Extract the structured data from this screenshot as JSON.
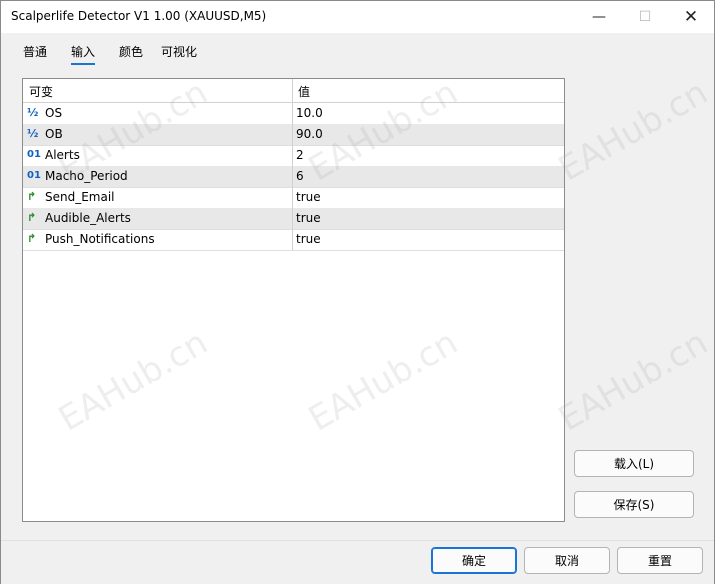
{
  "window": {
    "title": "Scalperlife Detector V1 1.00 (XAUUSD,M5)",
    "minimize_glyph": "—",
    "maximize_glyph": "☐",
    "close_glyph": "✕"
  },
  "tabs": [
    {
      "label": "普通"
    },
    {
      "label": "输入"
    },
    {
      "label": "颜色"
    },
    {
      "label": "可视化"
    }
  ],
  "active_tab": "输入",
  "grid": {
    "header": {
      "variable": "可变",
      "value": "值"
    },
    "rows": [
      {
        "icon": "fraction-icon",
        "glyph": "½",
        "name": "OS",
        "value": "10.0"
      },
      {
        "icon": "fraction-icon",
        "glyph": "½",
        "name": "OB",
        "value": "90.0"
      },
      {
        "icon": "integer-icon",
        "glyph": "01",
        "name": "Alerts",
        "value": "2"
      },
      {
        "icon": "integer-icon",
        "glyph": "01",
        "name": "Macho_Period",
        "value": "6"
      },
      {
        "icon": "boolean-icon",
        "glyph": "↱",
        "name": "Send_Email",
        "value": "true"
      },
      {
        "icon": "boolean-icon",
        "glyph": "↱",
        "name": "Audible_Alerts",
        "value": "true"
      },
      {
        "icon": "boolean-icon",
        "glyph": "↱",
        "name": "Push_Notifications",
        "value": "true"
      }
    ]
  },
  "side_buttons": {
    "load": "载入(L)",
    "save": "保存(S)"
  },
  "footer_buttons": {
    "ok": "确定",
    "cancel": "取消",
    "reset": "重置"
  },
  "watermark": "EAHub.cn",
  "colors": {
    "accent": "#1a73d6",
    "icon_blue": "#1060c0",
    "icon_green": "#2a8a2a"
  }
}
